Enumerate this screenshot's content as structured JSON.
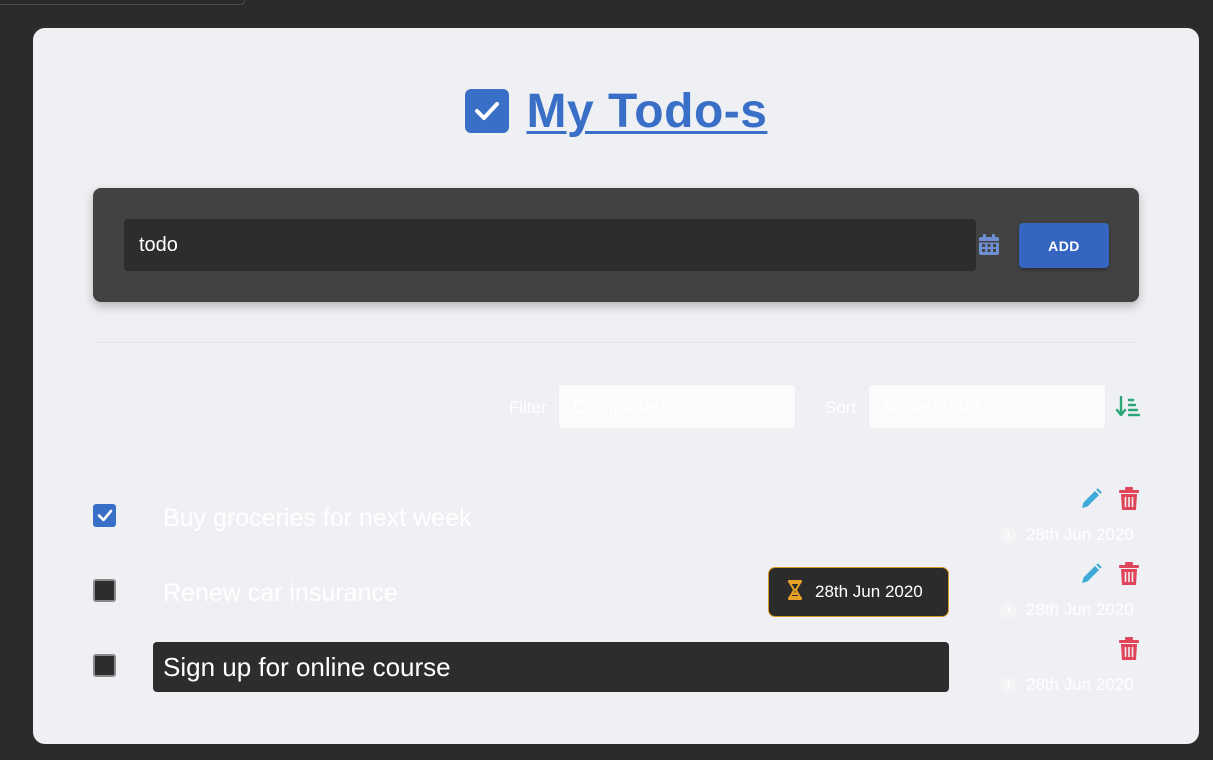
{
  "header": {
    "title": "My Todo-s",
    "logo_icon": "checkbox-icon"
  },
  "add_form": {
    "input_value": "todo",
    "calendar_icon": "calendar-icon",
    "add_label": "ADD"
  },
  "controls": {
    "filter_label": "Filter",
    "filter_value": "Completed",
    "sort_label": "Sort",
    "sort_value": "Added date",
    "sort_icon": "sort-ascending-icon"
  },
  "todos": [
    {
      "text": "Buy groceries for next week",
      "completed": true,
      "date": "28th Jun 2020"
    },
    {
      "text": "Renew car insurance",
      "completed": false,
      "date": "28th Jun 2020",
      "due_date": "28th Jun 2020"
    },
    {
      "text": "Sign up for online course",
      "completed": false,
      "date": "28th Jun 2020",
      "editing": true
    }
  ],
  "colors": {
    "accent": "#3a6fc8",
    "edit": "#3fa9d8",
    "delete": "#e0455a",
    "due_border": "#d79a2a",
    "sort": "#2aa678"
  }
}
